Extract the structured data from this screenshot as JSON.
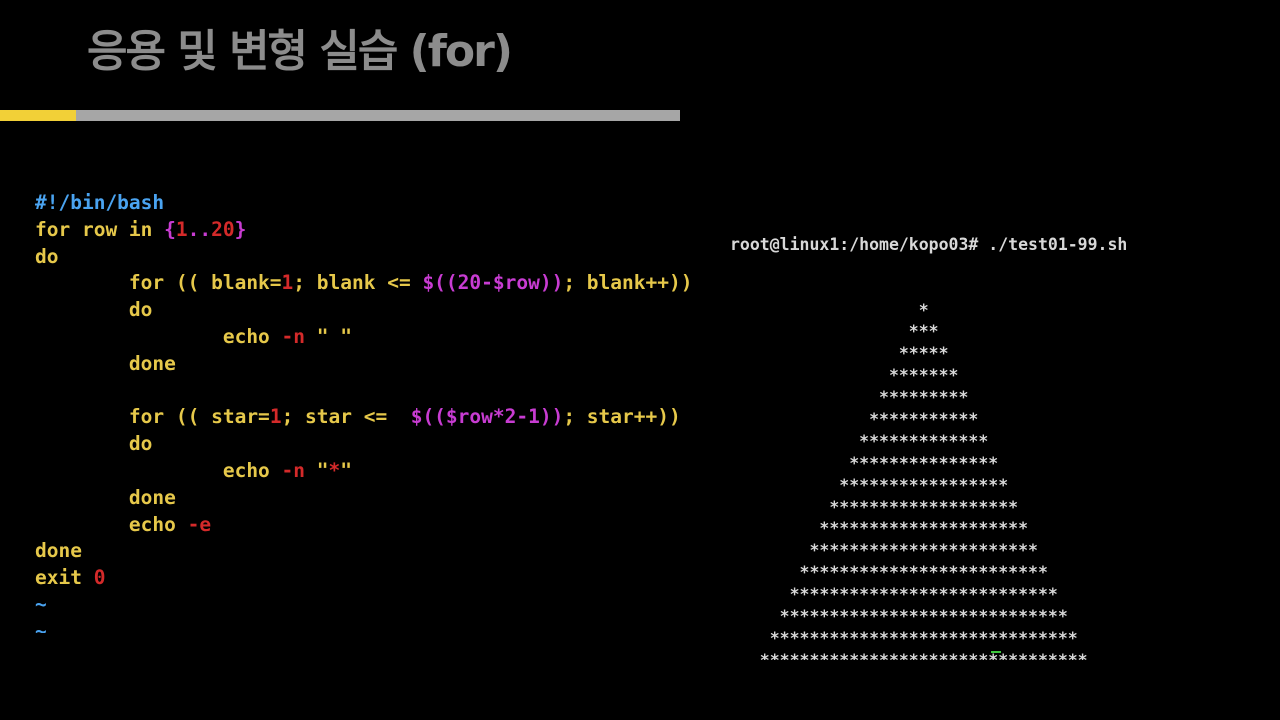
{
  "slide": {
    "title": "응용 및 변형 실습 (for)",
    "accent_color": "#f2d037",
    "bar_color": "#a6a6a6"
  },
  "code": {
    "lines": [
      [
        {
          "t": "#!/bin/bash",
          "c": "comment"
        }
      ],
      [
        {
          "t": "for row in ",
          "c": "keyword"
        },
        {
          "t": "{",
          "c": "magenta"
        },
        {
          "t": "1",
          "c": "red"
        },
        {
          "t": "..",
          "c": "magenta"
        },
        {
          "t": "20",
          "c": "red"
        },
        {
          "t": "}",
          "c": "magenta"
        }
      ],
      [
        {
          "t": "do",
          "c": "keyword"
        }
      ],
      [
        {
          "t": "        for (( blank=",
          "c": "keyword"
        },
        {
          "t": "1",
          "c": "red"
        },
        {
          "t": "; blank <= ",
          "c": "keyword"
        },
        {
          "t": "$((20-$row))",
          "c": "magenta"
        },
        {
          "t": "; blank++))",
          "c": "keyword"
        }
      ],
      [
        {
          "t": "        do",
          "c": "keyword"
        }
      ],
      [
        {
          "t": "                echo ",
          "c": "keyword"
        },
        {
          "t": "-n",
          "c": "red"
        },
        {
          "t": " \" \"",
          "c": "keyword"
        }
      ],
      [
        {
          "t": "        done",
          "c": "keyword"
        }
      ],
      [
        {
          "t": "",
          "c": "keyword"
        }
      ],
      [
        {
          "t": "        for (( star=",
          "c": "keyword"
        },
        {
          "t": "1",
          "c": "red"
        },
        {
          "t": "; star <=  ",
          "c": "keyword"
        },
        {
          "t": "$(($row*2-1))",
          "c": "magenta"
        },
        {
          "t": "; star++))",
          "c": "keyword"
        }
      ],
      [
        {
          "t": "        do",
          "c": "keyword"
        }
      ],
      [
        {
          "t": "                echo ",
          "c": "keyword"
        },
        {
          "t": "-n",
          "c": "red"
        },
        {
          "t": " \"",
          "c": "keyword"
        },
        {
          "t": "*",
          "c": "red"
        },
        {
          "t": "\"",
          "c": "keyword"
        }
      ],
      [
        {
          "t": "        done",
          "c": "keyword"
        }
      ],
      [
        {
          "t": "        echo ",
          "c": "keyword"
        },
        {
          "t": "-e",
          "c": "red"
        }
      ],
      [
        {
          "t": "done",
          "c": "keyword"
        }
      ],
      [
        {
          "t": "exit ",
          "c": "keyword"
        },
        {
          "t": "0",
          "c": "red"
        }
      ],
      [
        {
          "t": "~",
          "c": "tilde"
        }
      ],
      [
        {
          "t": "~",
          "c": "tilde"
        }
      ]
    ]
  },
  "terminal": {
    "prompt": "root@linux1:/home/kopo03# ./test01-99.sh",
    "lines": [
      "                   *",
      "                  ***",
      "                 *****",
      "                *******",
      "               *********",
      "              ***********",
      "             *************",
      "            ***************",
      "           *****************",
      "          *******************",
      "         *********************",
      "        ***********************",
      "       *************************",
      "      ***************************",
      "     *****************************",
      "    *******************************",
      "   *********************************",
      "  ***********************************",
      " *************************************",
      "***************************************"
    ]
  }
}
